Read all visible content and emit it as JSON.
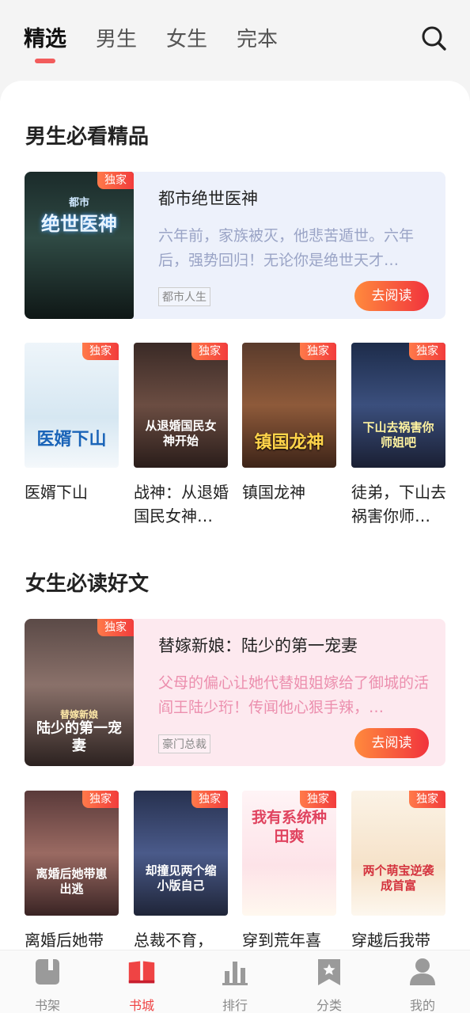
{
  "tabs": [
    {
      "label": "精选",
      "active": true
    },
    {
      "label": "男生"
    },
    {
      "label": "女生"
    },
    {
      "label": "完本"
    }
  ],
  "colors": {
    "accent": "#f25c5c",
    "read_button": "#f1333d",
    "male_feature_bg": "#edf1fb",
    "female_feature_bg": "#fde9ef"
  },
  "sections": [
    {
      "title": "男生必看精品",
      "feature": {
        "title": "都市绝世医神",
        "desc": "六年前，家族被灭，他悲苦遁世。六年后，强势回归！无论你是绝世天才…",
        "tag": "都市人生",
        "button": "去阅读",
        "badge": "独家",
        "cover_text": "绝世医神",
        "cover_sub": "都市"
      },
      "books": [
        {
          "name": "医婿下山",
          "badge": "独家",
          "cover_text": "医婿下山"
        },
        {
          "name": "战神：从退婚国民女神…",
          "badge": "独家",
          "cover_text": "从退婚国民女神开始"
        },
        {
          "name": "镇国龙神",
          "badge": "独家",
          "cover_text": "镇国龙神"
        },
        {
          "name": "徒弟，下山去祸害你师…",
          "badge": "独家",
          "cover_text": "下山去祸害你师姐吧"
        }
      ]
    },
    {
      "title": "女生必读好文",
      "feature": {
        "title": "替嫁新娘：陆少的第一宠妻",
        "desc": "父母的偏心让她代替姐姐嫁给了御城的活阎王陆少珩！传闻他心狠手辣，…",
        "tag": "豪门总裁",
        "button": "去阅读",
        "badge": "独家",
        "cover_text": "陆少的第一宠妻",
        "cover_sub": "替嫁新娘"
      },
      "books": [
        {
          "name": "离婚后她带",
          "badge": "独家",
          "cover_text": "离婚后她带崽出逃"
        },
        {
          "name": "总裁不育，",
          "badge": "独家",
          "cover_text": "却撞见两个缩小版自己"
        },
        {
          "name": "穿到荒年喜",
          "badge": "独家",
          "cover_text": "我有系统种田爽"
        },
        {
          "name": "穿越后我带",
          "badge": "独家",
          "cover_text": "两个萌宝逆袭成首富"
        }
      ]
    }
  ],
  "bottom_nav": [
    {
      "label": "书架",
      "icon": "bookshelf-icon"
    },
    {
      "label": "书城",
      "icon": "bookstore-icon",
      "active": true
    },
    {
      "label": "排行",
      "icon": "ranking-icon"
    },
    {
      "label": "分类",
      "icon": "category-icon"
    },
    {
      "label": "我的",
      "icon": "profile-icon"
    }
  ]
}
